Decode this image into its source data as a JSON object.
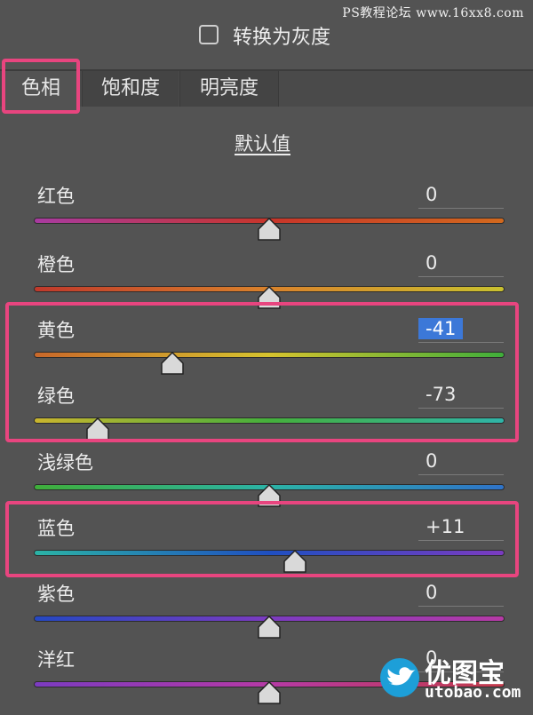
{
  "watermark": "PS教程论坛 www.16xx8.com",
  "grayscale": {
    "label": "转换为灰度",
    "checked": false
  },
  "tabs": [
    {
      "label": "色相",
      "active": true
    },
    {
      "label": "饱和度",
      "active": false
    },
    {
      "label": "明亮度",
      "active": false
    }
  ],
  "default_link": "默认值",
  "sliders": [
    {
      "label": "红色",
      "value": "0",
      "numeric": 0
    },
    {
      "label": "橙色",
      "value": "0",
      "numeric": 0
    },
    {
      "label": "黄色",
      "value": "-41",
      "numeric": -41,
      "selected": true
    },
    {
      "label": "绿色",
      "value": "-73",
      "numeric": -73
    },
    {
      "label": "浅绿色",
      "value": "0",
      "numeric": 0
    },
    {
      "label": "蓝色",
      "value": "+11",
      "numeric": 11
    },
    {
      "label": "紫色",
      "value": "0",
      "numeric": 0
    },
    {
      "label": "洋红",
      "value": "0",
      "numeric": 0
    }
  ],
  "slider_range": [
    -100,
    100
  ],
  "track_gradients": [
    [
      "#a83aa0",
      "#c8352a",
      "#d2691e"
    ],
    [
      "#c0392b",
      "#d9822b",
      "#c9c12f"
    ],
    [
      "#c9682a",
      "#d6c32e",
      "#3fae3a"
    ],
    [
      "#c9b52e",
      "#45b03c",
      "#2fb4a8"
    ],
    [
      "#3fae3a",
      "#2bb3a6",
      "#2f73c8"
    ],
    [
      "#2bb3a6",
      "#1f4fc0",
      "#7b3bc0"
    ],
    [
      "#2548c2",
      "#7b3bc0",
      "#b63aa6"
    ],
    [
      "#7b3bc0",
      "#b63aa6",
      "#c23a4a"
    ]
  ],
  "highlight_color": "#e8457f",
  "brand": {
    "name": "优图宝",
    "url": "utobao.com"
  }
}
